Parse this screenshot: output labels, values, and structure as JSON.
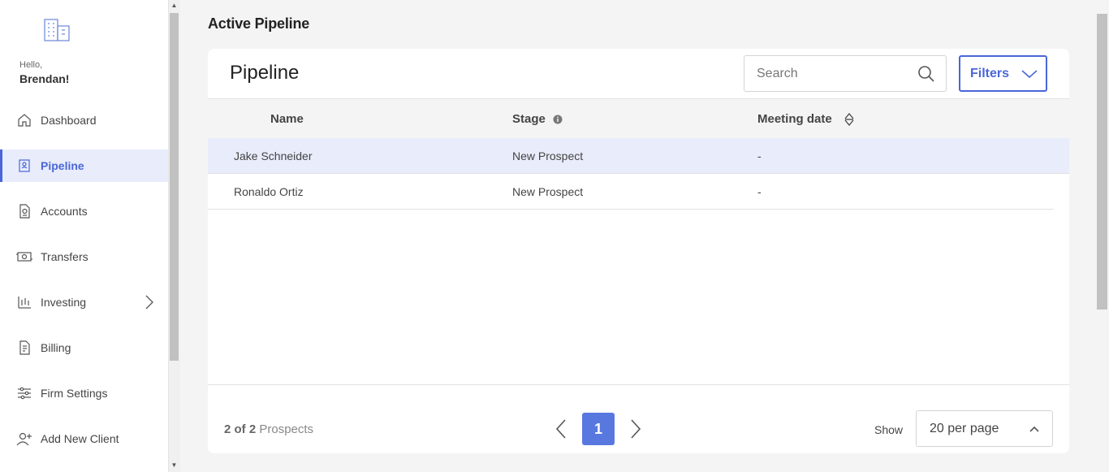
{
  "sidebar": {
    "greeting": "Hello,",
    "user_name": "Brendan!",
    "items": [
      {
        "label": "Dashboard",
        "icon": "home-icon"
      },
      {
        "label": "Pipeline",
        "icon": "contact-card-icon",
        "active": true
      },
      {
        "label": "Accounts",
        "icon": "document-icon"
      },
      {
        "label": "Transfers",
        "icon": "money-transfer-icon"
      },
      {
        "label": "Investing",
        "icon": "chart-icon",
        "has_submenu": true
      },
      {
        "label": "Billing",
        "icon": "invoice-icon"
      },
      {
        "label": "Firm Settings",
        "icon": "sliders-icon"
      },
      {
        "label": "Add New Client",
        "icon": "add-user-icon"
      }
    ]
  },
  "page": {
    "title": "Active Pipeline"
  },
  "card": {
    "title": "Pipeline",
    "search_placeholder": "Search",
    "filters_label": "Filters"
  },
  "table": {
    "columns": [
      "Name",
      "Stage",
      "Meeting date"
    ],
    "rows": [
      {
        "name": "Jake Schneider",
        "stage": "New Prospect",
        "meeting_date": "-"
      },
      {
        "name": "Ronaldo Ortiz",
        "stage": "New Prospect",
        "meeting_date": "-"
      }
    ]
  },
  "footer": {
    "count_bold": "2 of 2",
    "count_label": "Prospects",
    "current_page": "1",
    "show_label": "Show",
    "per_page": "20 per page"
  },
  "colors": {
    "accent": "#4a66d8",
    "page_button": "#5878e0",
    "highlight_row": "#e8ecfb"
  }
}
